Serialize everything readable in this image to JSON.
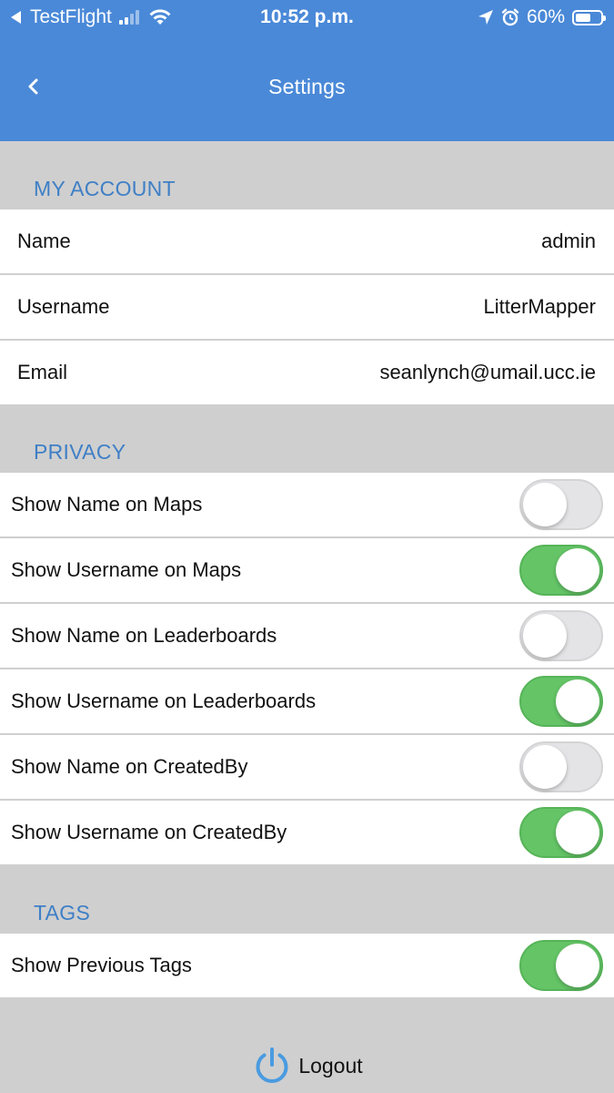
{
  "status_bar": {
    "carrier": "TestFlight",
    "time": "10:52 p.m.",
    "battery": "60%",
    "battery_level": 0.6
  },
  "header": {
    "title": "Settings"
  },
  "my_account": {
    "header": "MY ACCOUNT",
    "rows": [
      {
        "label": "Name",
        "value": "admin"
      },
      {
        "label": "Username",
        "value": "LitterMapper"
      },
      {
        "label": "Email",
        "value": "seanlynch@umail.ucc.ie"
      }
    ]
  },
  "privacy": {
    "header": "PRIVACY",
    "rows": [
      {
        "label": "Show Name on Maps",
        "on": false
      },
      {
        "label": "Show Username on Maps",
        "on": true
      },
      {
        "label": "Show Name on Leaderboards",
        "on": false
      },
      {
        "label": "Show Username on Leaderboards",
        "on": true
      },
      {
        "label": "Show Name on CreatedBy",
        "on": false
      },
      {
        "label": "Show Username on CreatedBy",
        "on": true
      }
    ]
  },
  "tags": {
    "header": "TAGS",
    "rows": [
      {
        "label": "Show Previous Tags",
        "on": true
      }
    ]
  },
  "logout": {
    "label": "Logout"
  },
  "colors": {
    "header_bg": "#4a89d8",
    "section_text": "#3f7fc6",
    "toggle_on": "#64c466",
    "toggle_off": "#e4e4e6",
    "logout_icon": "#4a9be0"
  }
}
